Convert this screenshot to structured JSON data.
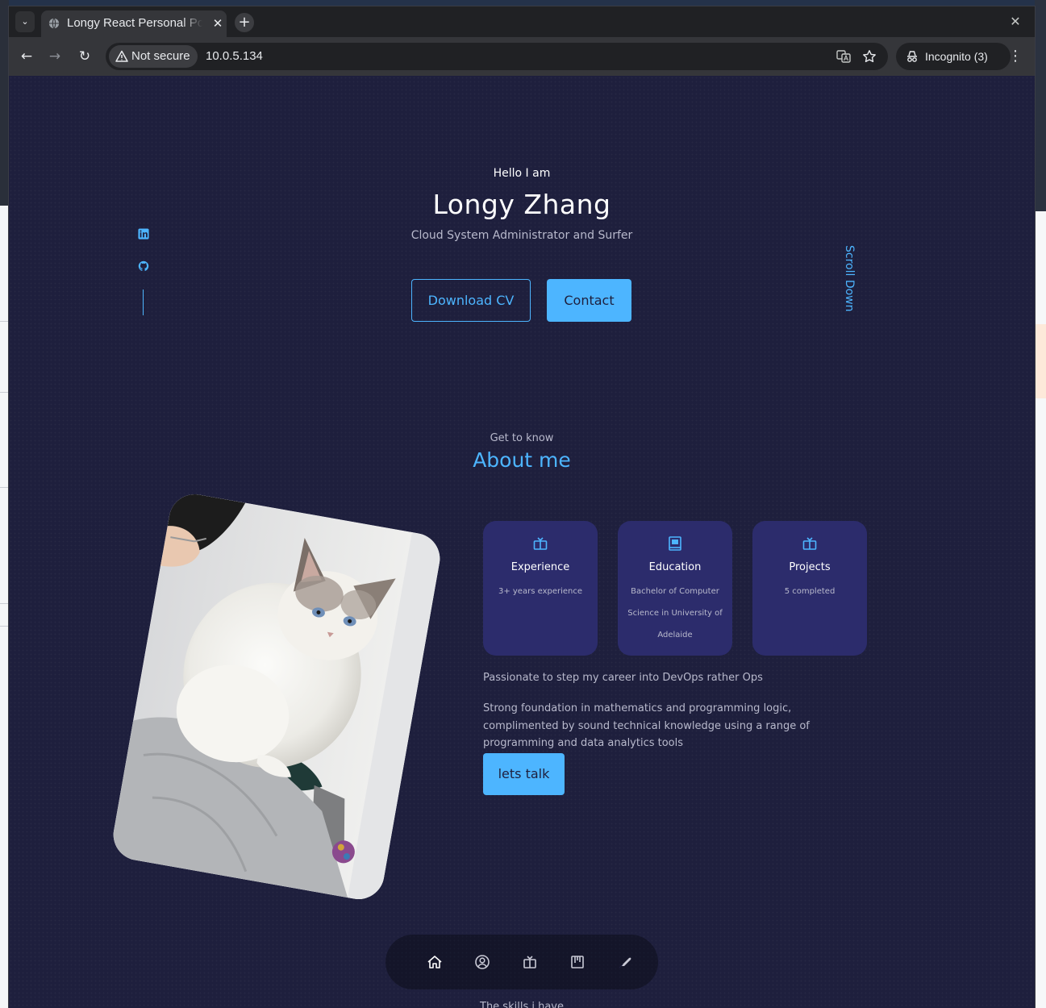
{
  "browser": {
    "tab_title": "Longy React Personal Portfolio",
    "security_label": "Not secure",
    "url": "10.0.5.134",
    "incognito_label": "Incognito (3)"
  },
  "hero": {
    "greeting": "Hello I am",
    "name": "Longy Zhang",
    "role": "Cloud System Administrator and Surfer",
    "download_cv_label": "Download CV",
    "contact_label": "Contact",
    "scroll_down_label": "Scroll Down"
  },
  "about": {
    "kicker": "Get to know",
    "title": "About me",
    "cards": [
      {
        "title": "Experience",
        "subtitle": "3+ years experience",
        "icon": "book-open-icon"
      },
      {
        "title": "Education",
        "subtitle": "Bachelor of Computer Science in University of Adelaide",
        "icon": "book-icon"
      },
      {
        "title": "Projects",
        "subtitle": "5 completed",
        "icon": "book-open-icon"
      }
    ],
    "paragraph_1": "Passionate to step my career into DevOps rather Ops",
    "paragraph_2": "Strong foundation in mathematics and programming logic, complimented by sound technical knowledge using a range of programming and data analytics tools",
    "cta_label": "lets talk"
  },
  "bottom_nav": {
    "icons": [
      "home-icon",
      "user-icon",
      "book-open-icon",
      "portfolio-icon",
      "feather-icon"
    ]
  },
  "skills": {
    "kicker": "The skills i have"
  },
  "colors": {
    "page_bg": "#1e1f3d",
    "accent": "#4db5ff",
    "card_bg": "#2c2c6c",
    "muted_text": "#b8b9cc"
  }
}
